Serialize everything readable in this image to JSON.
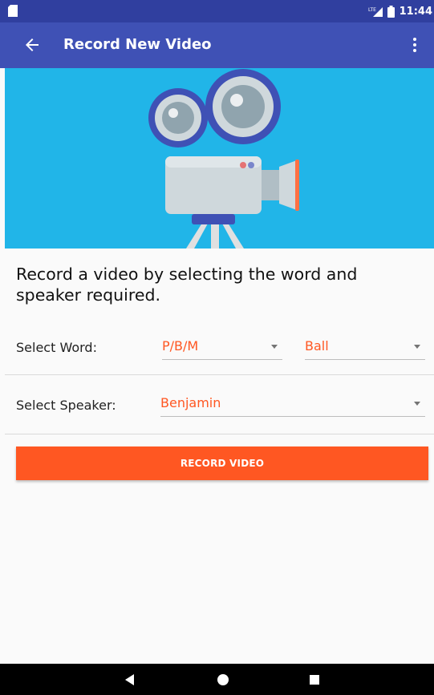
{
  "status_bar": {
    "time": "11:44",
    "network": "LTE"
  },
  "app_bar": {
    "title": "Record New Video"
  },
  "description": "Record a video by selecting the word and speaker required.",
  "word_row": {
    "label": "Select Word:",
    "category_value": "P/B/M",
    "word_value": "Ball"
  },
  "speaker_row": {
    "label": "Select Speaker:",
    "speaker_value": "Benjamin"
  },
  "record_button": {
    "label": "RECORD VIDEO"
  },
  "colors": {
    "status_bar": "#303f9f",
    "app_bar": "#3f51b5",
    "hero_bg": "#21b5e8",
    "accent": "#ff5722"
  },
  "icons": {
    "back": "arrow-left-icon",
    "menu": "overflow-menu-icon",
    "hero": "movie-camera-illustration",
    "nav_back": "nav-back-icon",
    "nav_home": "nav-home-icon",
    "nav_recents": "nav-recents-icon"
  }
}
